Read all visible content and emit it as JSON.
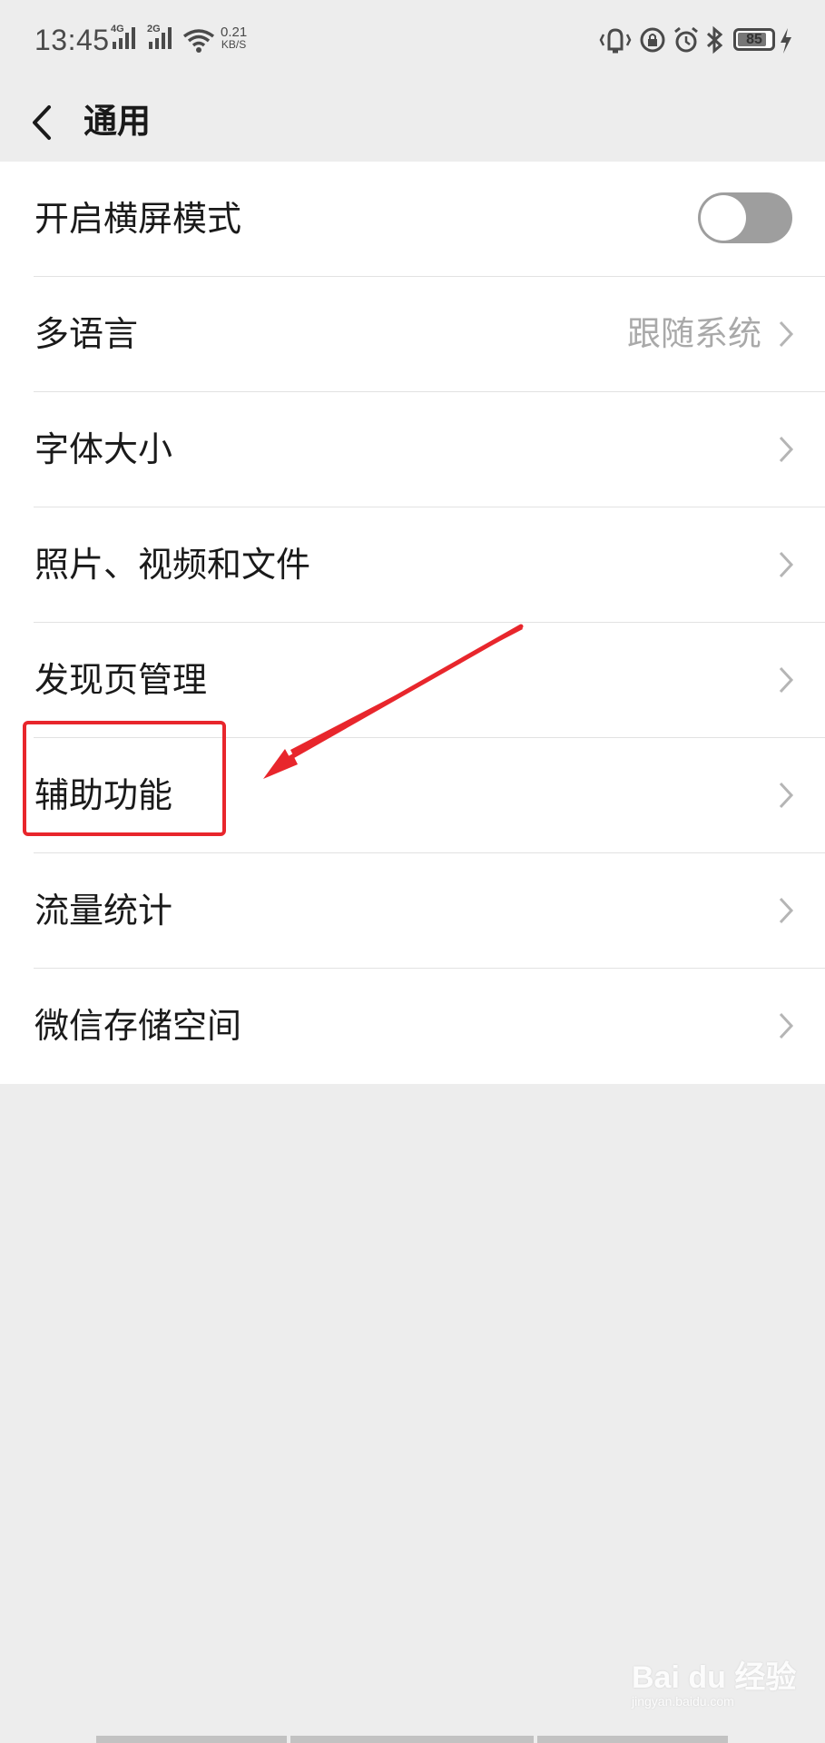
{
  "status_bar": {
    "time": "13:45",
    "signal_1": "4G",
    "signal_2": "2G",
    "speed_value": "0.21",
    "speed_unit": "KB/S",
    "battery": "85",
    "battery_level": 0.85,
    "icons": [
      "vibrate-icon",
      "lock-rotation-icon",
      "alarm-icon",
      "bluetooth-icon",
      "battery-icon",
      "charging-icon"
    ]
  },
  "header": {
    "title": "通用",
    "back_icon": "chevron-left-icon"
  },
  "settings": {
    "landscape": {
      "label": "开启横屏模式",
      "enabled": false
    },
    "language": {
      "label": "多语言",
      "value": "跟随系统"
    },
    "font_size": {
      "label": "字体大小"
    },
    "media": {
      "label": "照片、视频和文件"
    },
    "discover": {
      "label": "发现页管理"
    },
    "accessibility": {
      "label": "辅助功能"
    },
    "data_usage": {
      "label": "流量统计"
    },
    "storage": {
      "label": "微信存储空间"
    }
  },
  "annotation": {
    "highlight_color": "#e8262c",
    "highlighted_item": "辅助功能"
  },
  "watermark": {
    "brand": "Bai du 经验",
    "url": "jingyan.baidu.com"
  },
  "colors": {
    "background": "#ededed",
    "toggle_off": "#9e9e9e",
    "value_text": "#a9a9a9"
  }
}
